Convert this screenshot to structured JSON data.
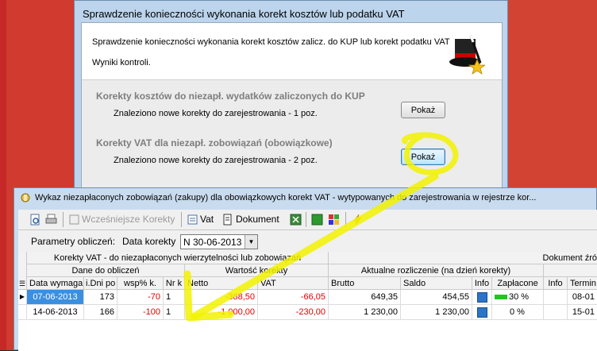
{
  "dialog": {
    "title": "Sprawdzenie konieczności wykonania korekt kosztów lub podatku VAT",
    "header_line1": "Sprawdzenie konieczności wykonania korekt kosztów zalicz. do KUP lub korekt podatku VAT",
    "header_line2": "Wyniki kontroli.",
    "section1": {
      "title": "Korekty kosztów do niezapł. wydatków zaliczonych do KUP",
      "text": "Znaleziono nowe korekty do zarejestrowania - 1 poz.",
      "button": "Pokaż"
    },
    "section2": {
      "title": "Korekty VAT dla niezapł. zobowiązań  (obowiązkowe)",
      "text": "Znaleziono nowe korekty do zarejestrowania - 2 poz.",
      "button": "Pokaż"
    }
  },
  "window": {
    "title": "Wykaz niezapłaconych zobowiązań (zakupy) dla obowiązkowych korekt VAT - wytypowanych do zarejestrowania w rejestrze kor...",
    "toolbar": {
      "earlier": "Wcześniejsze Korekty",
      "vat": "Vat",
      "document": "Dokument"
    },
    "params": {
      "label": "Parametry obliczeń:",
      "date_label": "Data korekty",
      "date_value": "N 30-06-2013"
    },
    "grid": {
      "group_left": "Korekty VAT - do niezapłaconych wierzytelności lub zobowiązań",
      "group_right": "Dokument źró",
      "sub1": "Dane do obliczeń",
      "sub2": "Wartość korekty",
      "sub3": "Aktualne rozliczenie (na dzień korekty)",
      "columns": [
        "Data wymagal",
        "i.Dni po",
        "wsp% k.",
        "Nr k",
        "Netto",
        "VAT",
        "Brutto",
        "Saldo",
        "Info",
        "Zapłacone",
        "Info",
        "Termin p"
      ],
      "rows": [
        {
          "date": "07-06-2013",
          "days": "173",
          "pct": "-70",
          "nr": "1",
          "netto": "-388,50",
          "vat": "-66,05",
          "brutto": "649,35",
          "saldo": "454,55",
          "paid": "30 %",
          "term": "08-01"
        },
        {
          "date": "14-06-2013",
          "days": "166",
          "pct": "-100",
          "nr": "1",
          "netto": "-1 000,00",
          "vat": "-230,00",
          "brutto": "1 230,00",
          "saldo": "1 230,00",
          "paid": "0 %",
          "term": "15-01"
        }
      ]
    }
  },
  "colors": {
    "selection": "#3b8fe0",
    "negative": "#e00000",
    "annotation": "#f2f200"
  }
}
